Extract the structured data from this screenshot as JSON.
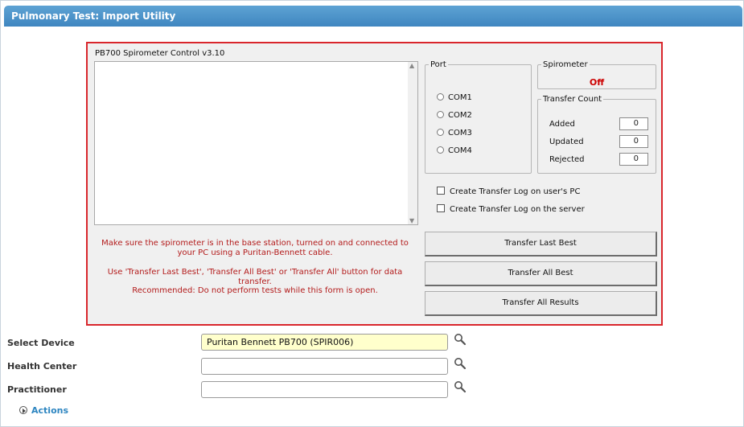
{
  "window": {
    "title": "Pulmonary Test: Import Utility"
  },
  "control": {
    "title": "PB700 Spirometer Control v3.10",
    "log_text": "",
    "instructions": [
      "Make sure the spirometer is in the base station, turned on and connected to your PC using a Puritan-Bennett cable.",
      "Use 'Transfer Last Best', 'Transfer All Best' or 'Transfer All' button for data transfer.",
      "Recommended: Do not perform tests while this form is open."
    ],
    "port": {
      "legend": "Port",
      "options": [
        "COM1",
        "COM2",
        "COM3",
        "COM4"
      ]
    },
    "spirometer": {
      "legend": "Spirometer",
      "status": "Off",
      "status_color": "#cc0000"
    },
    "transfer_count": {
      "legend": "Transfer Count",
      "rows": [
        {
          "label": "Added",
          "value": "0"
        },
        {
          "label": "Updated",
          "value": "0"
        },
        {
          "label": "Rejected",
          "value": "0"
        }
      ]
    },
    "checkboxes": [
      {
        "label": "Create Transfer Log on user's PC",
        "checked": false
      },
      {
        "label": "Create Transfer Log on the server",
        "checked": false
      }
    ],
    "buttons": {
      "last_best": "Transfer Last Best",
      "all_best": "Transfer All Best",
      "all_results": "Transfer All Results"
    }
  },
  "form": {
    "device": {
      "label": "Select Device",
      "value": "Puritan Bennett PB700 (SPIR006)"
    },
    "health_center": {
      "label": "Health Center",
      "value": ""
    },
    "practitioner": {
      "label": "Practitioner",
      "value": ""
    }
  },
  "actions": {
    "label": "Actions"
  },
  "colors": {
    "titlebar": "#4a90c8",
    "panel_border": "#d9262c",
    "warning_text": "#b31b1b",
    "link": "#2e86c1"
  }
}
